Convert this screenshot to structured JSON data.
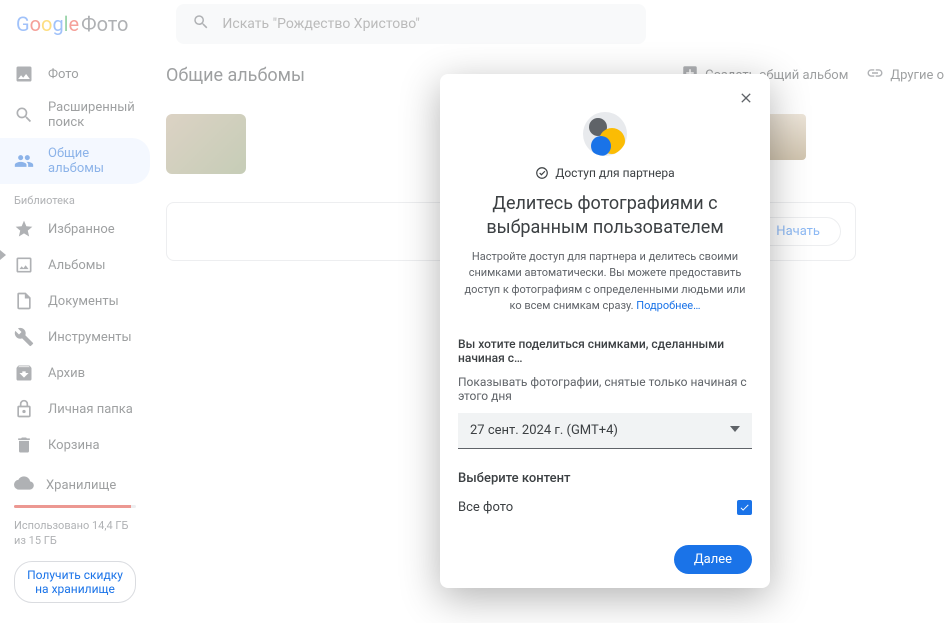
{
  "brand": {
    "google": "Google",
    "product": "Фото"
  },
  "search": {
    "placeholder": "Искать \"Рождество Христово\""
  },
  "sidebar": {
    "items": [
      "Фото",
      "Расширенный поиск",
      "Общие альбомы"
    ],
    "library_label": "Библиотека",
    "library_items": [
      "Избранное",
      "Альбомы",
      "Документы",
      "Инструменты",
      "Архив",
      "Личная папка",
      "Корзина"
    ]
  },
  "storage": {
    "title": "Хранилище",
    "used_text": "Использовано 14,4 ГБ из 15 ГБ",
    "cta": "Получить скидку на хранилище"
  },
  "main": {
    "title": "Общие альбомы",
    "create_label": "Создать общий альбом",
    "other_label": "Другие о"
  },
  "partner_card": {
    "start": "Начать"
  },
  "dialog": {
    "badge": "Доступ для партнера",
    "title": "Делитесь фотографиями с выбранным пользователем",
    "desc": "Настройте доступ для партнера и делитесь своими снимками автоматически. Вы можете предоставить доступ к фотографиям с определенными людьми или ко всем снимкам сразу.",
    "learn_more": "Подробнее…",
    "share_since_q": "Вы хотите поделиться снимками, сделанными начиная с…",
    "date_hint": "Показывать фотографии, снятые только начиная с этого дня",
    "date_value": "27 сент. 2024 г. (GMT+4)",
    "content_title": "Выберите контент",
    "all_photos": "Все фото",
    "next": "Далее"
  }
}
